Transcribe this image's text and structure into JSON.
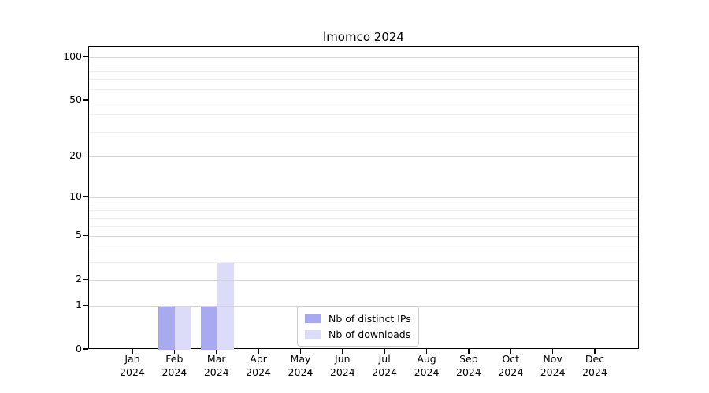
{
  "chart_data": {
    "type": "bar",
    "title": "lmomco 2024",
    "categories": [
      "Jan",
      "Feb",
      "Mar",
      "Apr",
      "May",
      "Jun",
      "Jul",
      "Aug",
      "Sep",
      "Oct",
      "Nov",
      "Dec"
    ],
    "year_label": "2024",
    "series": [
      {
        "name": "Nb of distinct IPs",
        "color": "#a9a9f0",
        "values": [
          0,
          1,
          1,
          0,
          0,
          0,
          0,
          0,
          0,
          0,
          0,
          0
        ]
      },
      {
        "name": "Nb of downloads",
        "color": "#dcdcf8",
        "values": [
          0,
          1,
          3,
          0,
          0,
          0,
          0,
          0,
          0,
          0,
          0,
          0
        ]
      }
    ],
    "xlabel": "",
    "ylabel": "",
    "yscale": "log1p",
    "ylim": [
      0,
      100
    ],
    "y_major_ticks": [
      0,
      1,
      2,
      5,
      10,
      20,
      50,
      100
    ],
    "y_minor_gridlines": [
      3,
      4,
      6,
      7,
      8,
      9,
      30,
      40,
      60,
      70,
      80,
      90
    ],
    "grid": true,
    "grid_over_bars": true,
    "legend_position": "lower center",
    "colors": {
      "axis": "#000000",
      "major_grid": "#d4d4d4",
      "minor_grid": "#f0f0f0",
      "background": "#ffffff"
    }
  }
}
